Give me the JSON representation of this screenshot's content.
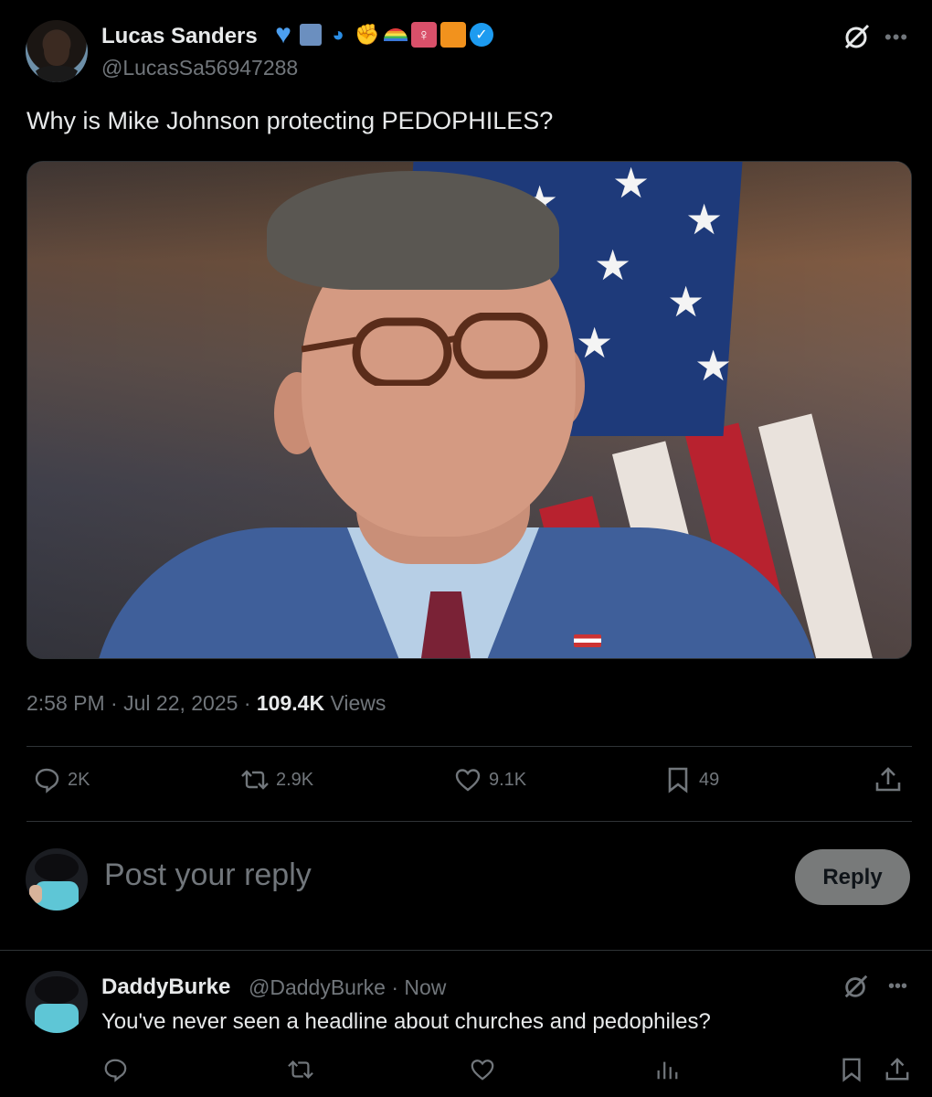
{
  "post": {
    "author_name": "Lucas Sanders",
    "author_handle": "@LucasSa56947288",
    "badges": [
      "blue-heart-emoji",
      "floppy-disk-emoji",
      "water-wave-emoji",
      "flexed-biceps-emoji",
      "rainbow-emoji",
      "standing-person-emoji",
      "orange-square-emoji",
      "verified-badge"
    ],
    "text": "Why is Mike Johnson protecting PEDOPHILES?",
    "time": "2:58 PM",
    "date": "Jul 22, 2025",
    "views_count": "109.4K",
    "views_label": "Views",
    "replies": "2K",
    "reposts": "2.9K",
    "likes": "9.1K",
    "bookmarks": "49"
  },
  "reply_box": {
    "placeholder": "Post your reply",
    "button_label": "Reply"
  },
  "comment": {
    "author_name": "DaddyBurke",
    "author_handle": "@DaddyBurke",
    "time": "Now",
    "text": "You've never seen a headline about churches and pedophiles?"
  },
  "colors": {
    "background": "#000000",
    "text": "#e7e9ea",
    "muted": "#71767b",
    "divider": "#2f3336",
    "verified": "#1d9bf0",
    "reply_button": "#787a7a"
  }
}
